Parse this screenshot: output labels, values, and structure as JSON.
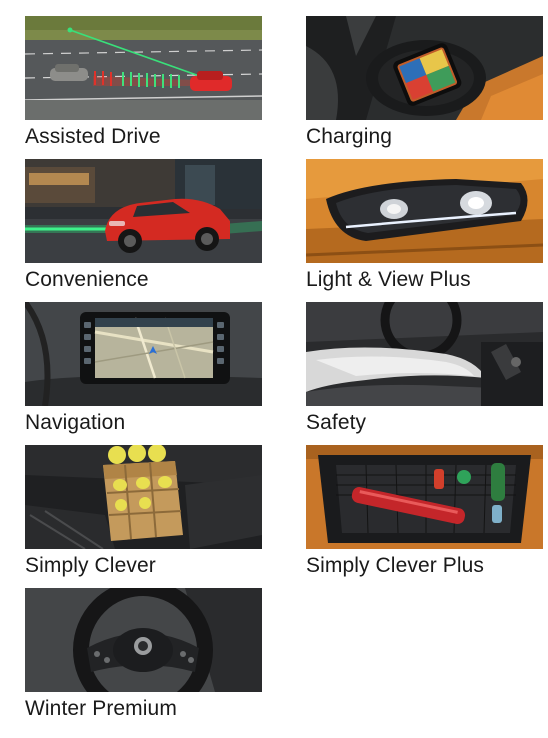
{
  "packages": [
    {
      "label": "Assisted Drive",
      "image": "car-radar-highway-photo"
    },
    {
      "label": "Charging",
      "image": "wireless-phone-charger-photo"
    },
    {
      "label": "Convenience",
      "image": "red-car-parking-sensors-photo"
    },
    {
      "label": "Light & View Plus",
      "image": "led-headlight-photo"
    },
    {
      "label": "Navigation",
      "image": "infotainment-navigation-screen-photo"
    },
    {
      "label": "Safety",
      "image": "knee-airbag-interior-photo"
    },
    {
      "label": "Simply Clever",
      "image": "boot-storage-crate-photo"
    },
    {
      "label": "Simply Clever Plus",
      "image": "boot-cargo-net-photo"
    },
    {
      "label": "Winter Premium",
      "image": "heated-steering-wheel-photo"
    }
  ]
}
